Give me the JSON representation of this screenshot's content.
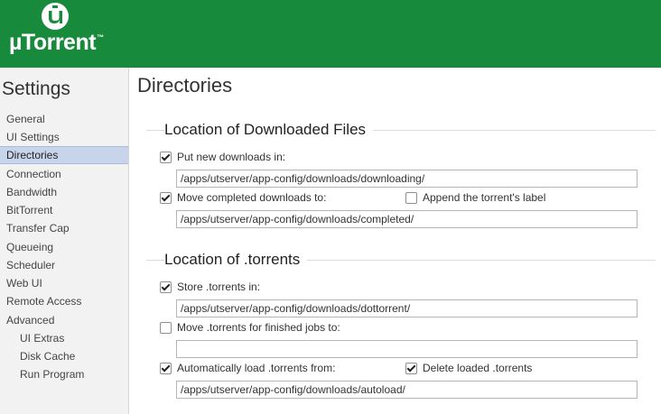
{
  "brand": {
    "name": "µTorrent",
    "tm": "™"
  },
  "sidebar": {
    "title": "Settings",
    "items": [
      {
        "label": "General"
      },
      {
        "label": "UI Settings"
      },
      {
        "label": "Directories",
        "selected": true
      },
      {
        "label": "Connection"
      },
      {
        "label": "Bandwidth"
      },
      {
        "label": "BitTorrent"
      },
      {
        "label": "Transfer Cap"
      },
      {
        "label": "Queueing"
      },
      {
        "label": "Scheduler"
      },
      {
        "label": "Web UI"
      },
      {
        "label": "Remote Access"
      },
      {
        "label": "Advanced"
      },
      {
        "label": "UI Extras",
        "sub": true
      },
      {
        "label": "Disk Cache",
        "sub": true
      },
      {
        "label": "Run Program",
        "sub": true
      }
    ]
  },
  "main": {
    "title": "Directories",
    "downloaded": {
      "title": "Location of Downloaded Files",
      "put_new": {
        "label": "Put new downloads in:",
        "checked": true,
        "value": "/apps/utserver/app-config/downloads/downloading/"
      },
      "move_completed": {
        "label": "Move completed downloads to:",
        "checked": true,
        "value": "/apps/utserver/app-config/downloads/completed/"
      },
      "append_label": {
        "label": "Append the torrent's label",
        "checked": false
      }
    },
    "torrents": {
      "title": "Location of .torrents",
      "store": {
        "label": "Store .torrents in:",
        "checked": true,
        "value": "/apps/utserver/app-config/downloads/dottorrent/"
      },
      "move_finished": {
        "label": "Move .torrents for finished jobs to:",
        "checked": false,
        "value": ""
      },
      "autoload": {
        "label": "Automatically load .torrents from:",
        "checked": true,
        "value": "/apps/utserver/app-config/downloads/autoload/"
      },
      "delete_loaded": {
        "label": "Delete loaded .torrents",
        "checked": true
      }
    }
  },
  "colors": {
    "brand_green": "#178a3c",
    "selected_bg": "#c7d4ea"
  }
}
